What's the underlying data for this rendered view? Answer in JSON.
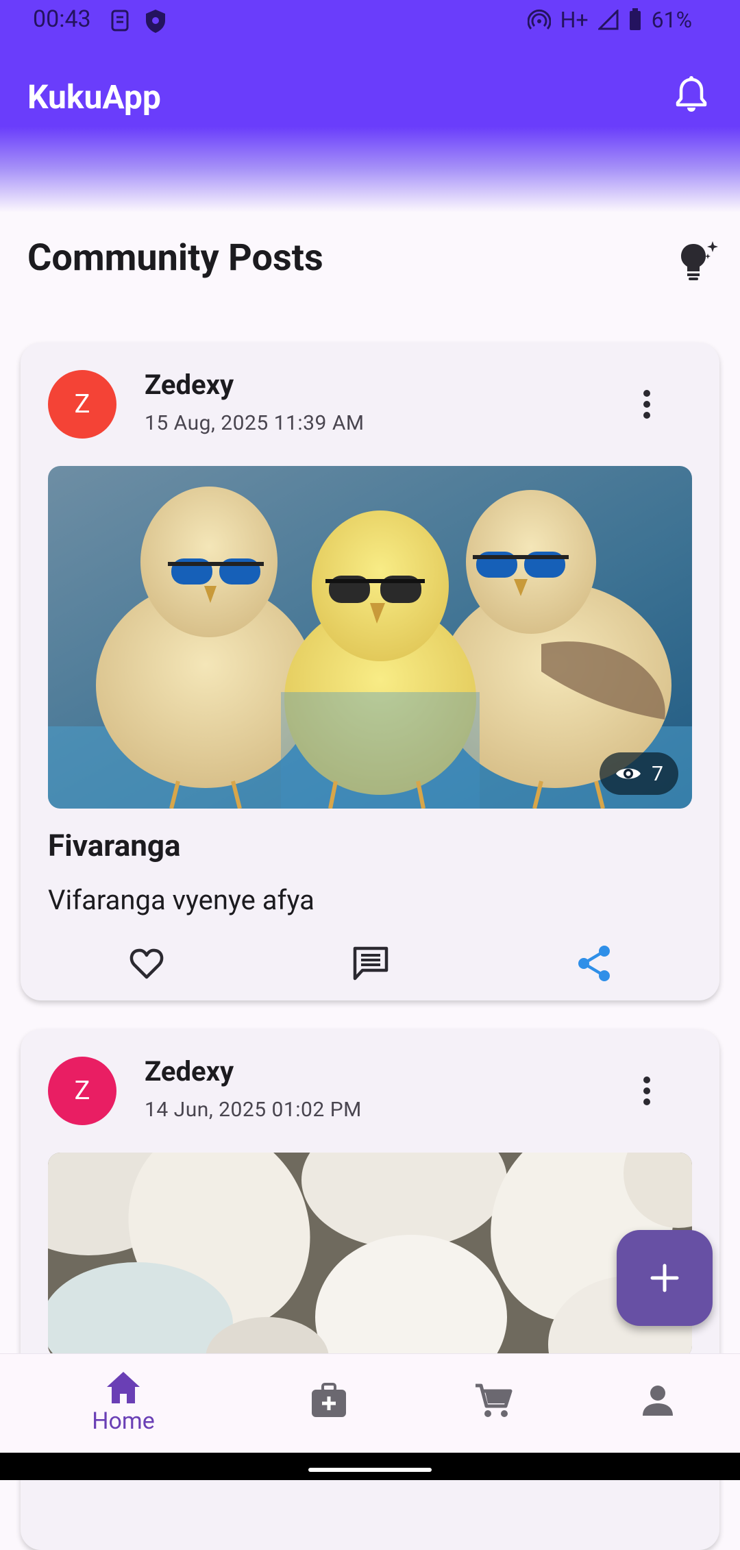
{
  "status_bar": {
    "time": "00:43",
    "network": "H+",
    "battery": "61%"
  },
  "app_bar": {
    "title": "KukuApp",
    "icon": "bell-icon"
  },
  "section": {
    "title": "Community Posts",
    "icon": "lightbulb-sparkle-icon"
  },
  "posts": [
    {
      "avatar_letter": "Z",
      "avatar_color": "#F44336",
      "author": "Zedexy",
      "date": "15 Aug, 2025 11:39 AM",
      "views": "7",
      "title": "Fivaranga",
      "body": "Vifaranga vyenye afya",
      "image": "three-chicks-with-sunglasses"
    },
    {
      "avatar_letter": "Z",
      "avatar_color": "#E91E63",
      "author": "Zedexy",
      "date": "14 Jun, 2025 01:02 PM",
      "image": "white-eggs"
    }
  ],
  "nav": [
    {
      "label": "Home",
      "icon": "home-icon",
      "active": true
    },
    {
      "label": "",
      "icon": "medical-kit-icon"
    },
    {
      "label": "",
      "icon": "cart-icon"
    },
    {
      "label": "",
      "icon": "person-icon"
    }
  ],
  "colors": {
    "primary": "#6A3DFB",
    "fab": "#6750A4",
    "share": "#2F8FE8"
  }
}
